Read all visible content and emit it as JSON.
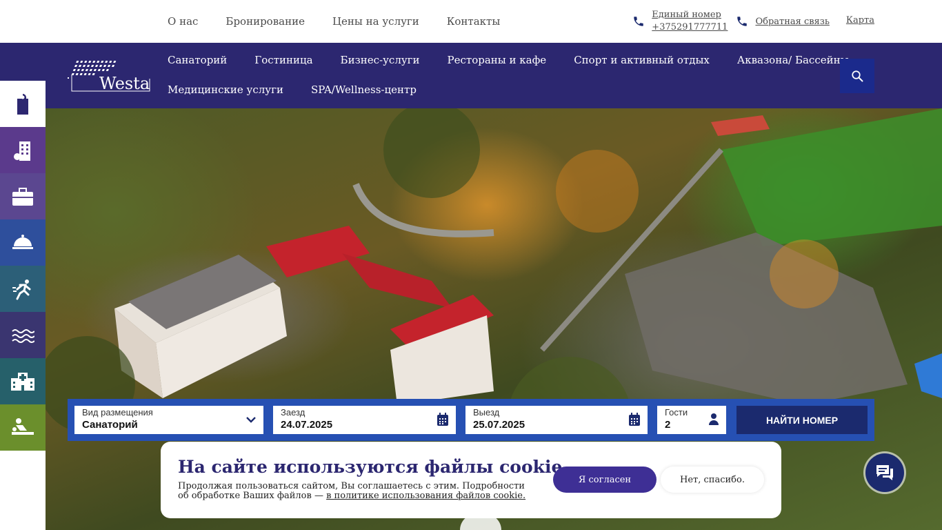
{
  "top_nav": [
    {
      "label": "О нас"
    },
    {
      "label": "Бронирование"
    },
    {
      "label": "Цены на услуги"
    },
    {
      "label": "Контакты"
    }
  ],
  "contacts": {
    "phone_label": "Единый номер",
    "phone_number": "+375291777711",
    "feedback": "Обратная связь",
    "map": "Карта"
  },
  "logo": {
    "text": "Westa"
  },
  "main_nav": {
    "row1": [
      {
        "label": "Санаторий"
      },
      {
        "label": "Гостиница"
      },
      {
        "label": "Бизнес-услуги"
      },
      {
        "label": "Рестораны и кафе"
      },
      {
        "label": "Спорт и активный отдых"
      },
      {
        "label": "Аквазона/ Бассейны"
      }
    ],
    "row2": [
      {
        "label": "Медицинские услуги"
      },
      {
        "label": "SPA/Wellness-центр"
      }
    ]
  },
  "side_icons": [
    {
      "name": "door-hanger-icon",
      "bg": "#ffffff"
    },
    {
      "name": "hotel-icon",
      "bg": "#5b3a8c"
    },
    {
      "name": "briefcase-icon",
      "bg": "#5b4790"
    },
    {
      "name": "cloche-icon",
      "bg": "#2e4f9c"
    },
    {
      "name": "runner-icon",
      "bg": "#2c5f78"
    },
    {
      "name": "waves-icon",
      "bg": "#3a3570"
    },
    {
      "name": "hospital-icon",
      "bg": "#26606a"
    },
    {
      "name": "massage-icon",
      "bg": "#6b8f2c"
    }
  ],
  "booking": {
    "type_label": "Вид размещения",
    "type_value": "Санаторий",
    "checkin_label": "Заезд",
    "checkin_value": "24.07.2025",
    "checkout_label": "Выезд",
    "checkout_value": "25.07.2025",
    "guests_label": "Гости",
    "guests_value": "2",
    "find_button": "НАЙТИ НОМЕР"
  },
  "cookie": {
    "title": "На сайте используются файлы cookie.",
    "text": "Продолжая пользоваться сайтом, Вы соглашаетесь с этим. Подробности об обработке Ваших файлов — ",
    "link": "в политике использования файлов cookie.",
    "agree": "Я согласен",
    "decline": "Нет, спасибо."
  },
  "colors": {
    "brand_dark": "#2c2770",
    "booking_bar": "#2650b3",
    "button_dark": "#1b2a6e"
  }
}
